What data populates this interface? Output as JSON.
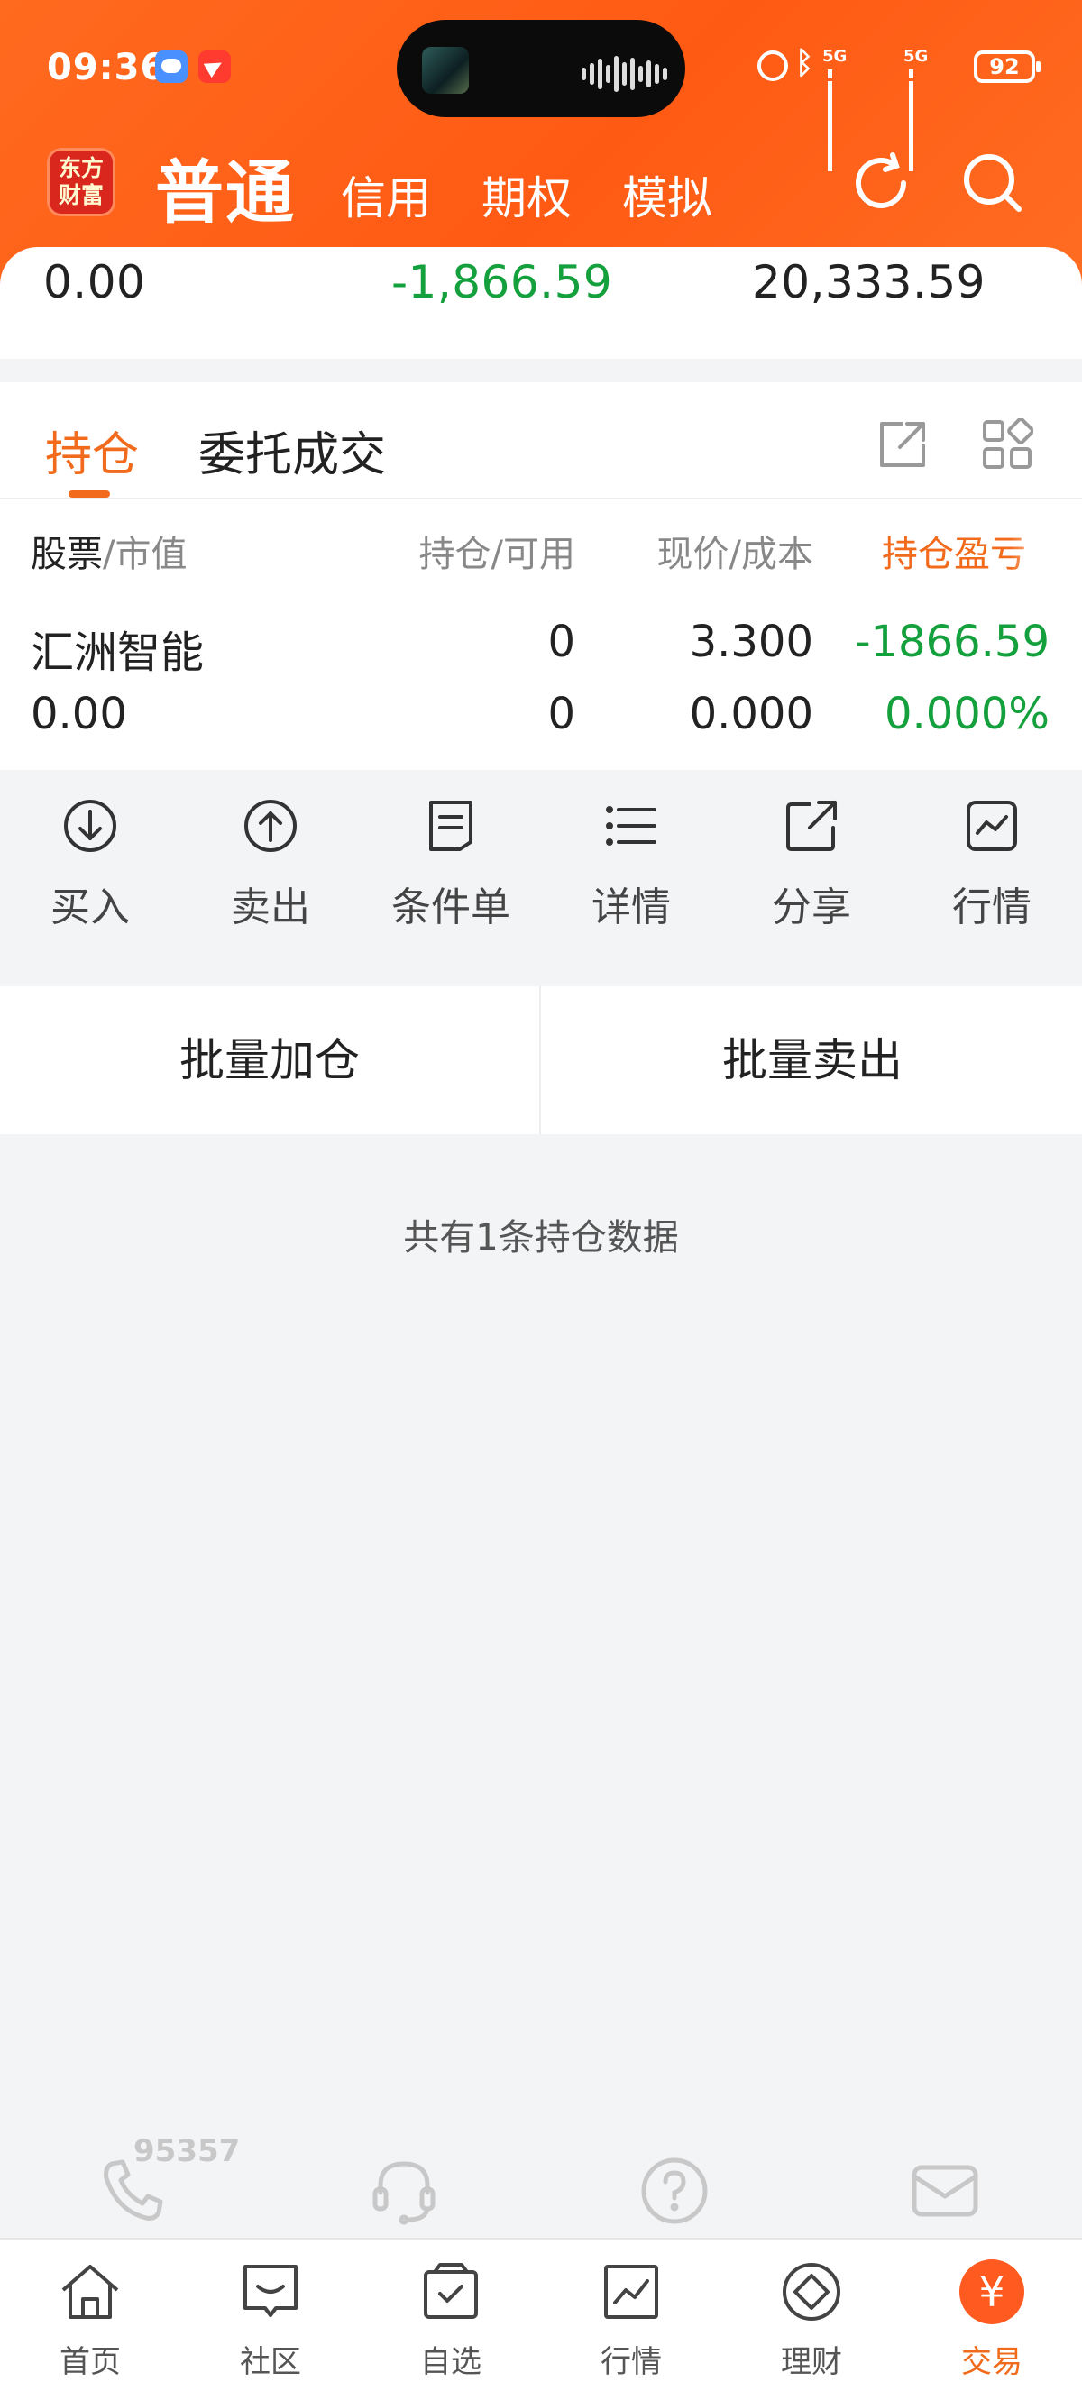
{
  "status_bar": {
    "time": "09:36",
    "battery": "92",
    "signal_1": "5G",
    "signal_2": "5G"
  },
  "header": {
    "logo_line1": "东方",
    "logo_line2": "财富",
    "tabs": {
      "normal": "普通",
      "credit": "信用",
      "options": "期权",
      "simulated": "模拟"
    },
    "icons": [
      "refresh-icon",
      "search-icon"
    ],
    "colors": {
      "brand_orange": "#ff5a14",
      "logo_red": "#d9271d"
    }
  },
  "summary": {
    "market_value": "0.00",
    "position_pl": "-1,866.59",
    "total_assets": "20,333.59"
  },
  "positions": {
    "tabs": {
      "holdings": "持仓",
      "orders": "委托成交"
    },
    "columns": {
      "stock": "股票",
      "market_value": "/市值",
      "qty": "持仓/可用",
      "price": "现价/成本",
      "pl": "持仓盈亏"
    },
    "rows": [
      {
        "name": "汇洲智能",
        "market_value": "0.00",
        "holding": "0",
        "available": "0",
        "price": "3.300",
        "cost": "0.000",
        "pl": "-1866.59",
        "pl_pct": "0.000%"
      }
    ],
    "colors": {
      "accent": "#f26a1b",
      "loss_green": "#14a03c"
    }
  },
  "actions": [
    {
      "label": "买入",
      "icon": "buy-icon"
    },
    {
      "label": "卖出",
      "icon": "sell-icon"
    },
    {
      "label": "条件单",
      "icon": "conditional-order-icon"
    },
    {
      "label": "详情",
      "icon": "details-list-icon"
    },
    {
      "label": "分享",
      "icon": "share-icon"
    },
    {
      "label": "行情",
      "icon": "quote-chart-icon"
    }
  ],
  "batch": {
    "add": "批量加仓",
    "sell": "批量卖出"
  },
  "records_note": "共有1条持仓数据",
  "service": {
    "hotline": "95357",
    "icons": [
      "phone-icon",
      "headset-icon",
      "help-icon",
      "mail-icon"
    ]
  },
  "bottom_nav": [
    {
      "label": "首页",
      "icon": "home-icon"
    },
    {
      "label": "社区",
      "icon": "community-icon"
    },
    {
      "label": "自选",
      "icon": "watchlist-icon"
    },
    {
      "label": "行情",
      "icon": "market-icon"
    },
    {
      "label": "理财",
      "icon": "wealth-icon"
    },
    {
      "label": "交易",
      "icon": "trade-icon",
      "badge": "¥",
      "active": true
    }
  ]
}
